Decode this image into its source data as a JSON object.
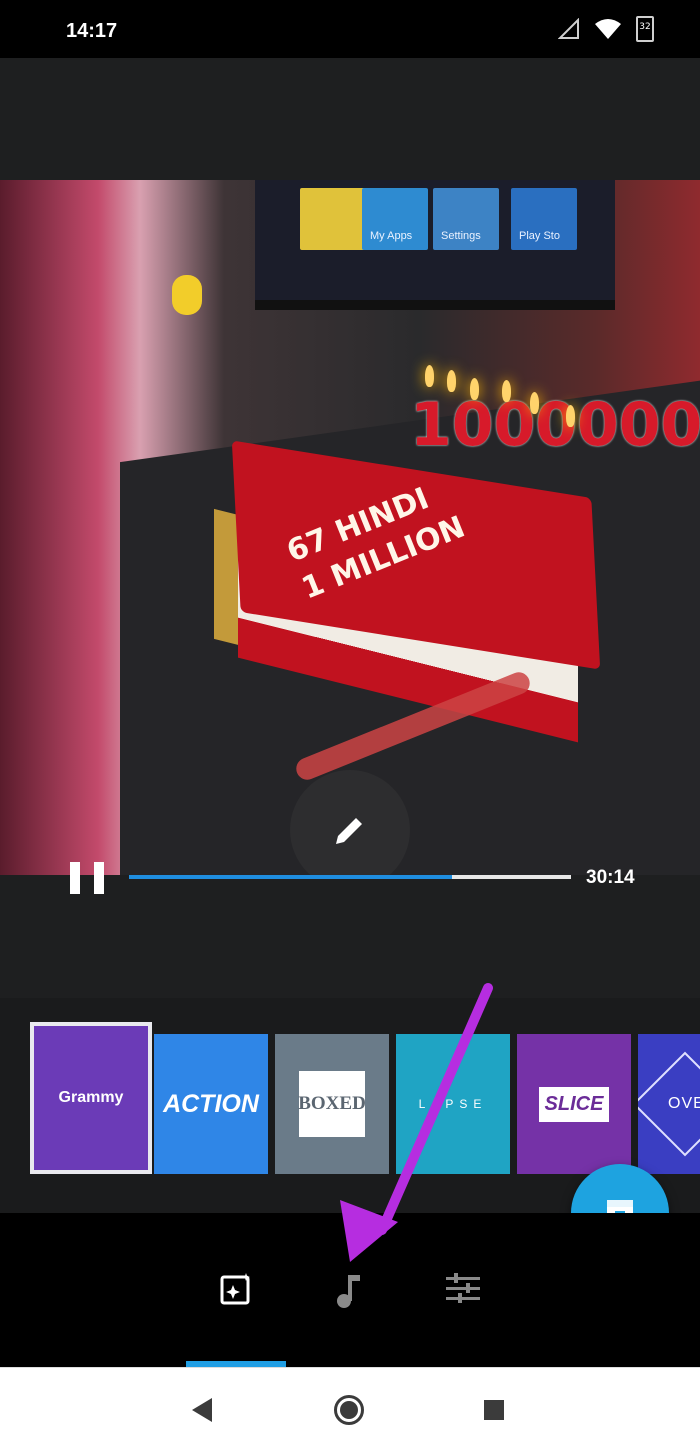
{
  "status": {
    "time": "14:17",
    "battery": "32"
  },
  "video": {
    "cake_text_line1": "67 HINDI",
    "cake_text_line2": "1 MILLION",
    "candles_text": "1000000",
    "tv_tiles": [
      "",
      "My Apps",
      "Settings",
      "Play Sto"
    ],
    "progress_fraction": 0.73,
    "time_label": "30:14"
  },
  "themes": {
    "selected": "Grammy",
    "items": [
      "Grammy",
      "ACTION",
      "BOXED",
      "LAPSE",
      "SLICE",
      "OVE"
    ]
  },
  "tabs": {
    "items": [
      "filters-icon",
      "music-icon",
      "adjust-icon"
    ],
    "active_index": 0
  },
  "colors": {
    "accent": "#1f9ee4",
    "annotation_arrow": "#b62de0"
  }
}
